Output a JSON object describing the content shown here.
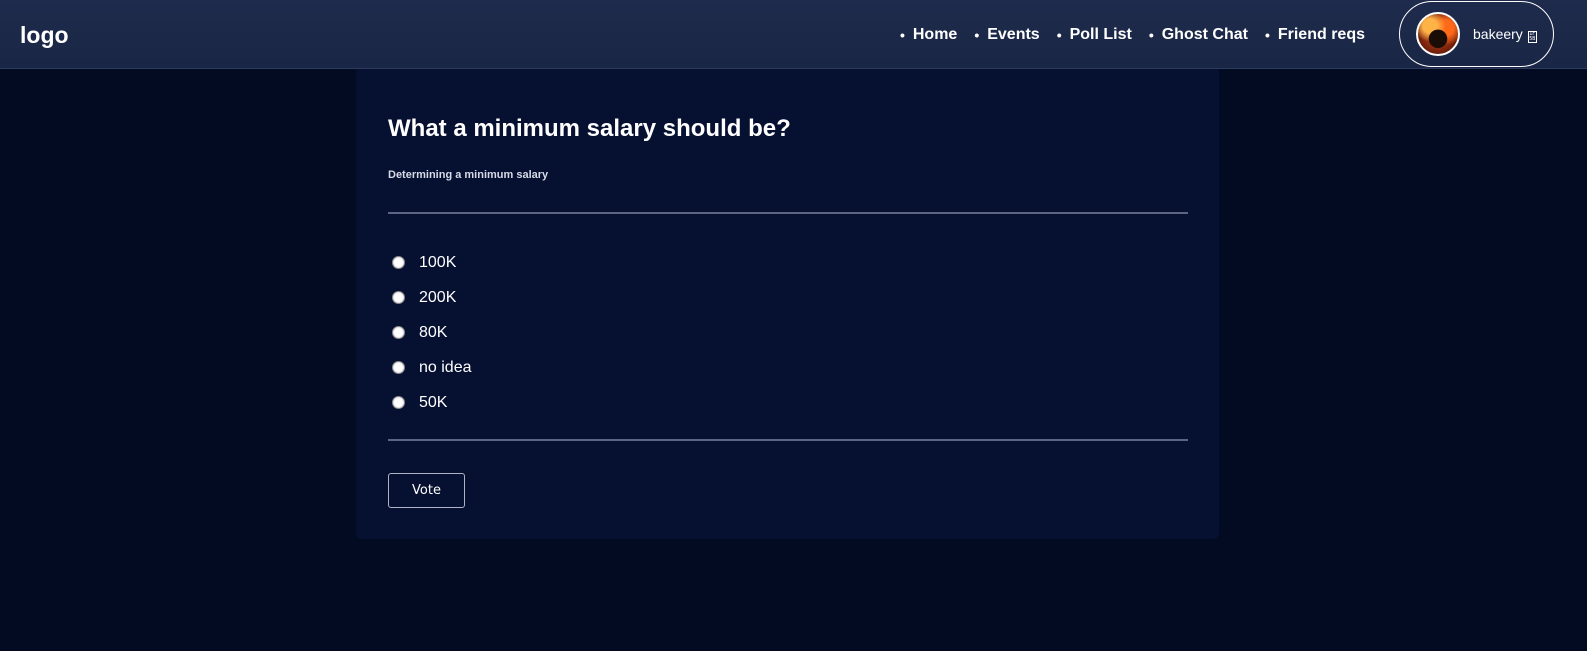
{
  "header": {
    "logo": "logo",
    "nav": [
      {
        "label": "Home"
      },
      {
        "label": "Events"
      },
      {
        "label": "Poll List"
      },
      {
        "label": "Ghost Chat"
      },
      {
        "label": "Friend reqs"
      }
    ],
    "user": {
      "name": "bakeery",
      "avatar_icon": "user-avatar-image",
      "trailing_glyph": "missing-glyph-box"
    }
  },
  "poll": {
    "title": "What a minimum salary should be?",
    "description": "Determining a minimum salary",
    "options": [
      {
        "label": "100K",
        "selected": false
      },
      {
        "label": "200K",
        "selected": false
      },
      {
        "label": "80K",
        "selected": false
      },
      {
        "label": "no idea",
        "selected": false
      },
      {
        "label": "50K",
        "selected": false
      }
    ],
    "vote_label": "Vote"
  },
  "colors": {
    "page_bg": "#020b22",
    "navbar_bg": "#1e2b4c",
    "card_bg": "#061031",
    "divider": "#5b6480",
    "text": "#ffffff"
  }
}
